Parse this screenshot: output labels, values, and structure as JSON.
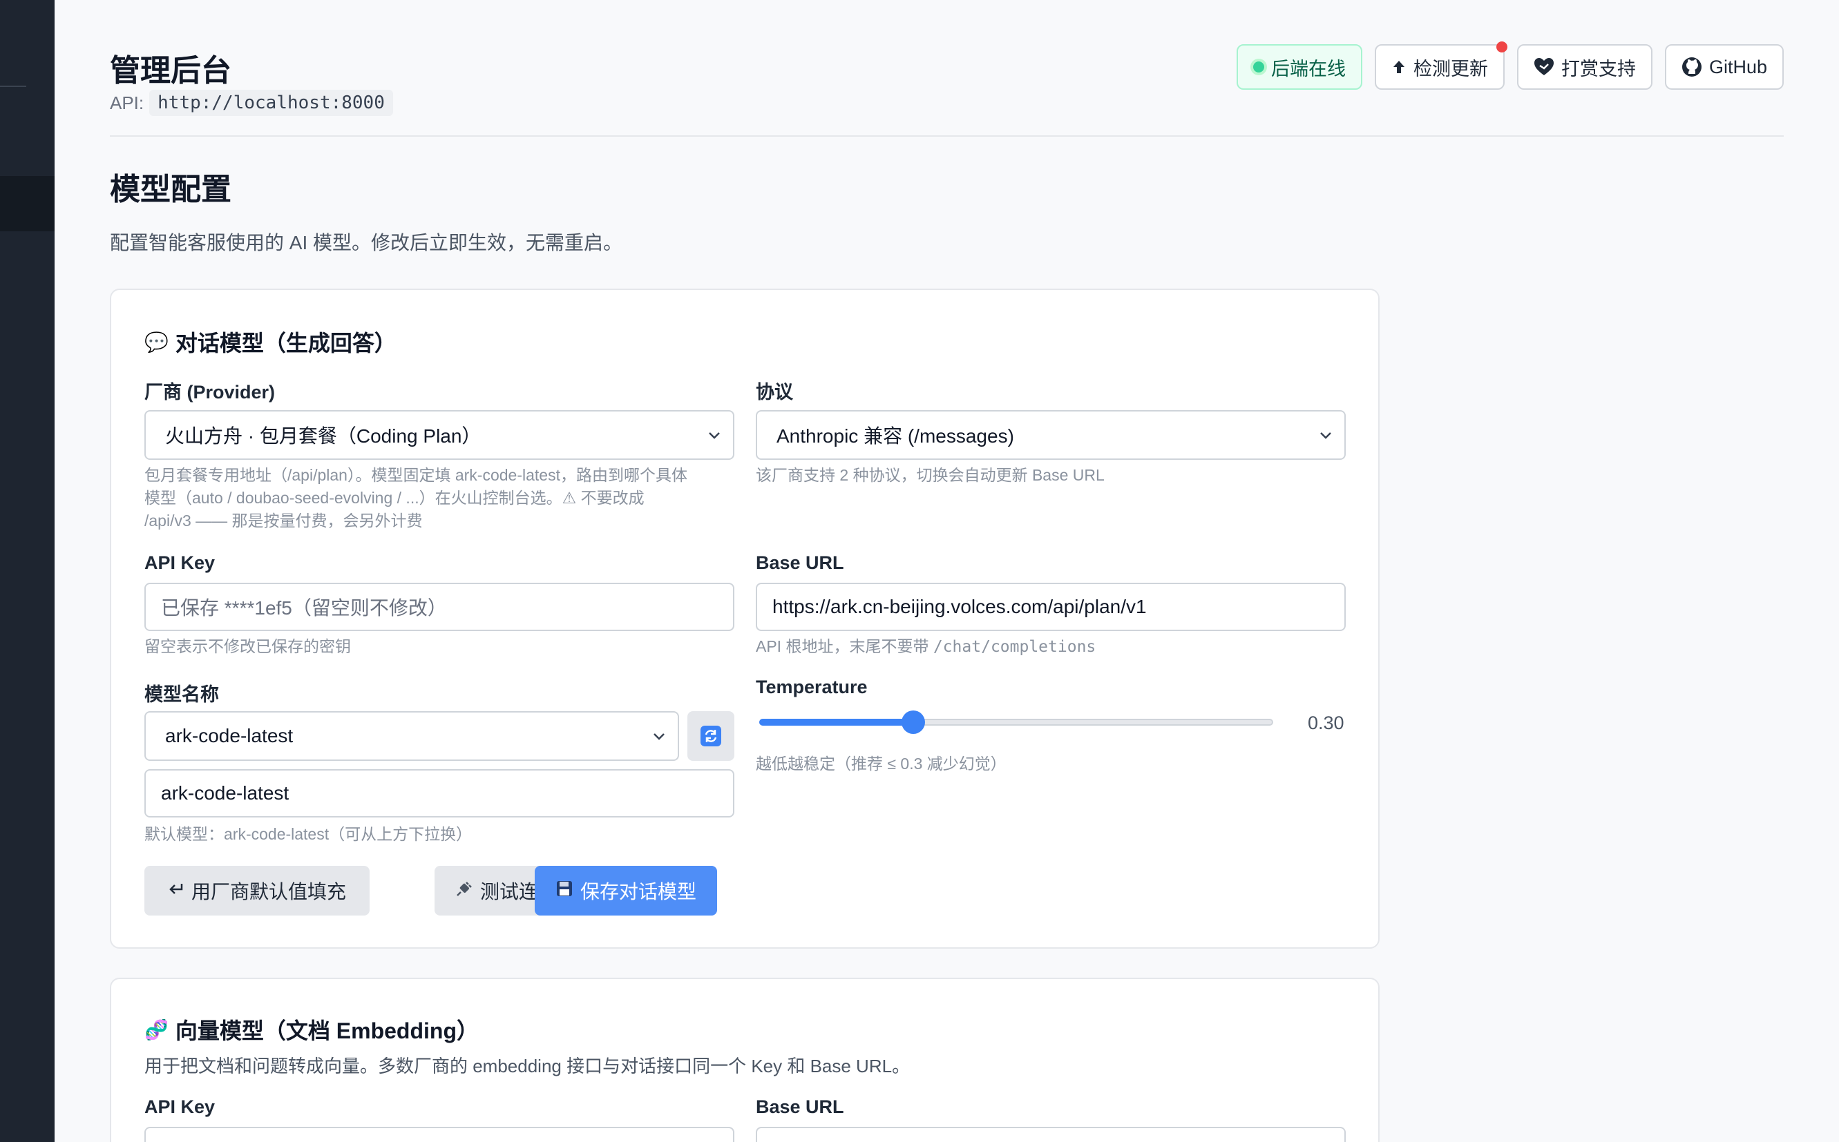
{
  "header": {
    "title": "管理后台",
    "api_label": "API:",
    "api_url": "http://localhost:8000",
    "status_label": "后端在线",
    "check_update_label": "检测更新",
    "donate_label": "打赏支持",
    "github_label": "GitHub"
  },
  "section": {
    "title": "模型配置",
    "description": "配置智能客服使用的 AI 模型。修改后立即生效，无需重启。"
  },
  "chat_card": {
    "emoji": "💬",
    "title": "对话模型（生成回答）",
    "provider_label": "厂商 (Provider)",
    "provider_value": "火山方舟 · 包月套餐（Coding Plan）",
    "provider_hint_1": "包月套餐专用地址（/api/plan）。模型固定填 ark-code-latest，路由到哪个具体",
    "provider_hint_2": "模型（auto / doubao-seed-evolving / ...）在火山控制台选。⚠ 不要改成",
    "provider_hint_3": "/api/v3 —— 那是按量付费，会另外计费",
    "protocol_label": "协议",
    "protocol_value": "Anthropic 兼容 (/messages)",
    "protocol_hint": "该厂商支持 2 种协议，切换会自动更新 Base URL",
    "api_key_label": "API Key",
    "api_key_placeholder": "已保存 ****1ef5（留空则不修改）",
    "api_key_hint": "留空表示不修改已保存的密钥",
    "base_url_label": "Base URL",
    "base_url_value": "https://ark.cn-beijing.volces.com/api/plan/v1",
    "base_url_hint_prefix": "API 根地址，末尾不要带 ",
    "base_url_hint_code": "/chat/completions",
    "model_label": "模型名称",
    "model_select_value": "ark-code-latest",
    "model_input_value": "ark-code-latest",
    "model_hint": "默认模型：ark-code-latest（可从上方下拉换）",
    "temperature_label": "Temperature",
    "temperature_value": "0.30",
    "temperature_fraction": 0.3,
    "temperature_hint": "越低越稳定（推荐 ≤ 0.3 减少幻觉）",
    "fill_default_label": "用厂商默认值填充",
    "test_label": "测试连接",
    "save_label": "保存对话模型"
  },
  "embedding_card": {
    "emoji": "🧬",
    "title": "向量模型（文档 Embedding）",
    "description": "用于把文档和问题转成向量。多数厂商的 embedding 接口与对话接口同一个 Key 和 Base URL。",
    "api_key_label": "API Key",
    "base_url_label": "Base URL"
  },
  "colors": {
    "sidebar": "#1e2530",
    "accent": "#3b82f6",
    "save_button": "#4f8ef7",
    "online_green": "#34d399",
    "update_dot": "#ef4444"
  }
}
